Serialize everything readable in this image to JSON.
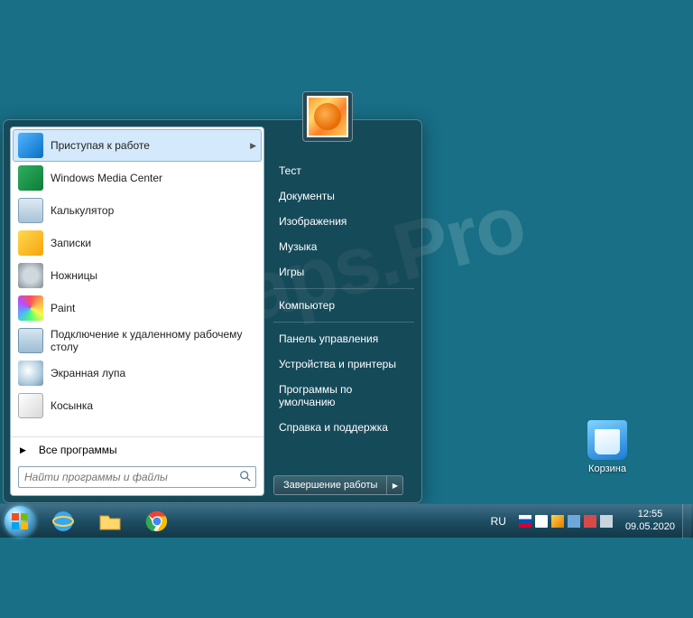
{
  "desktop": {
    "recycle_bin": "Корзина"
  },
  "startmenu": {
    "programs": [
      "Приступая к работе",
      "Windows Media Center",
      "Калькулятор",
      "Записки",
      "Ножницы",
      "Paint",
      "Подключение к удаленному рабочему столу",
      "Экранная лупа",
      "Косынка"
    ],
    "all_programs": "Все программы",
    "search_placeholder": "Найти программы и файлы",
    "right": [
      "Тест",
      "Документы",
      "Изображения",
      "Музыка",
      "Игры",
      "Компьютер",
      "Панель управления",
      "Устройства и принтеры",
      "Программы по умолчанию",
      "Справка и поддержка"
    ],
    "shutdown": "Завершение работы"
  },
  "taskbar": {
    "lang": "RU",
    "time": "12:55",
    "date": "09.05.2020"
  },
  "watermark": "Fraps.Pro"
}
